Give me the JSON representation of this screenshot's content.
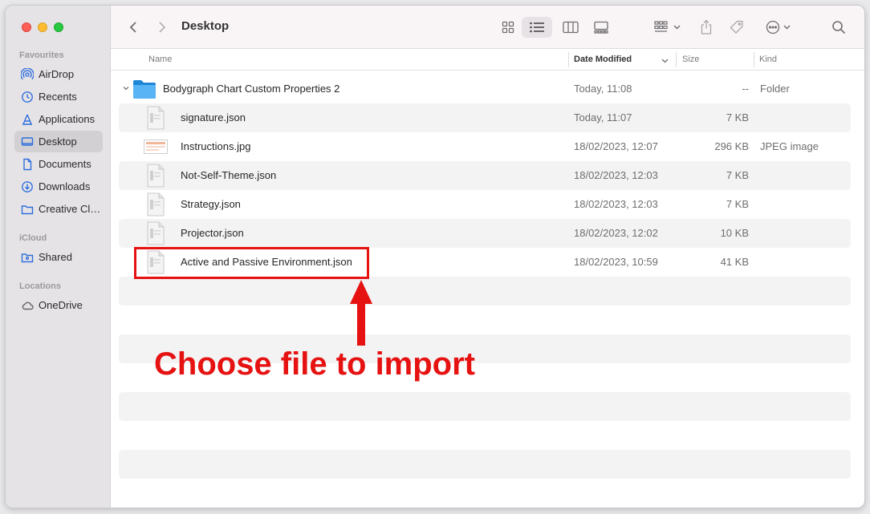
{
  "window": {
    "title": "Desktop"
  },
  "sidebar": {
    "sections": [
      {
        "label": "Favourites",
        "items": [
          {
            "label": "AirDrop",
            "icon": "airdrop-icon"
          },
          {
            "label": "Recents",
            "icon": "clock-icon"
          },
          {
            "label": "Applications",
            "icon": "applications-icon"
          },
          {
            "label": "Desktop",
            "icon": "desktop-icon",
            "active": true
          },
          {
            "label": "Documents",
            "icon": "document-icon"
          },
          {
            "label": "Downloads",
            "icon": "download-icon"
          },
          {
            "label": "Creative Cloud Files",
            "icon": "folder-icon"
          }
        ]
      },
      {
        "label": "iCloud",
        "items": [
          {
            "label": "Shared",
            "icon": "shared-folder-icon"
          }
        ]
      },
      {
        "label": "Locations",
        "items": [
          {
            "label": "OneDrive",
            "icon": "cloud-icon"
          }
        ]
      }
    ]
  },
  "columns": {
    "name": "Name",
    "date": "Date Modified",
    "size": "Size",
    "kind": "Kind"
  },
  "files": [
    {
      "name": "Bodygraph Chart Custom Properties 2",
      "date": "Today, 11:08",
      "size": "--",
      "kind": "Folder",
      "type": "folder"
    },
    {
      "name": "signature.json",
      "date": "Today, 11:07",
      "size": "7 KB",
      "kind": "",
      "type": "doc"
    },
    {
      "name": "Instructions.jpg",
      "date": "18/02/2023, 12:07",
      "size": "296 KB",
      "kind": "JPEG image",
      "type": "image"
    },
    {
      "name": "Not-Self-Theme.json",
      "date": "18/02/2023, 12:03",
      "size": "7 KB",
      "kind": "",
      "type": "doc"
    },
    {
      "name": "Strategy.json",
      "date": "18/02/2023, 12:03",
      "size": "7 KB",
      "kind": "",
      "type": "doc"
    },
    {
      "name": "Projector.json",
      "date": "18/02/2023, 12:02",
      "size": "10 KB",
      "kind": "",
      "type": "doc"
    },
    {
      "name": "Active and Passive Environment.json",
      "date": "18/02/2023, 10:59",
      "size": "41 KB",
      "kind": "",
      "type": "doc"
    }
  ],
  "annotation": {
    "text": "Choose file to import",
    "color": "#e61212"
  },
  "colors": {
    "accent": "#2f6fde",
    "folder": "#3fa2ee"
  }
}
